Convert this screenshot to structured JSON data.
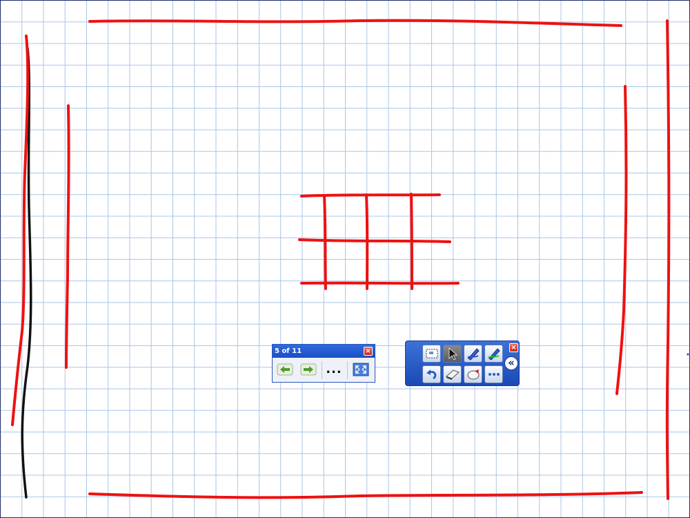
{
  "canvas": {
    "grid_color": "#a9c6e6",
    "ink_colors": {
      "red": "#ee1111",
      "black": "#111111"
    }
  },
  "page_navigation": {
    "page_indicator": "5 of 11",
    "close_label": "×",
    "buttons": [
      {
        "name": "previous-page",
        "icon": "left-arrow-icon"
      },
      {
        "name": "next-page",
        "icon": "right-arrow-icon"
      },
      {
        "name": "more-options",
        "icon": "ellipsis-icon",
        "label": "..."
      },
      {
        "name": "full-screen",
        "icon": "full-screen-icon"
      }
    ]
  },
  "drawing_tools": {
    "close_label": "×",
    "collapse_label": "«",
    "row1": [
      {
        "name": "capture-tool",
        "icon": "capture-icon"
      },
      {
        "name": "select-tool",
        "icon": "pointer-icon",
        "active": true
      },
      {
        "name": "pen-tool-blue",
        "icon": "pen-icon"
      },
      {
        "name": "pen-tool-green",
        "icon": "pen-icon"
      }
    ],
    "row2": [
      {
        "name": "undo-tool",
        "icon": "undo-icon"
      },
      {
        "name": "eraser-tool",
        "icon": "eraser-icon"
      },
      {
        "name": "shapes-tool",
        "icon": "shapes-icon"
      },
      {
        "name": "more-tools",
        "icon": "ellipsis-icon"
      }
    ]
  }
}
